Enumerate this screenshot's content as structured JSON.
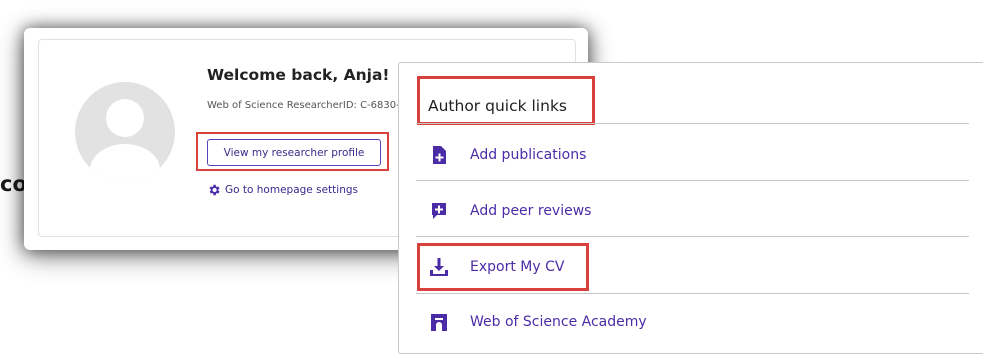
{
  "welcome": {
    "title": "Welcome back, Anja!",
    "researcher_id": "Web of Science ResearcherID: C-6830-",
    "profile_button": "View my researcher profile",
    "settings_link": "Go to homepage settings"
  },
  "partial_text": "co",
  "quick_links": {
    "title": "Author quick links",
    "items": [
      {
        "label": "Add publications",
        "icon": "document-plus-icon"
      },
      {
        "label": "Add peer reviews",
        "icon": "review-plus-icon"
      },
      {
        "label": "Export My CV",
        "icon": "download-icon"
      },
      {
        "label": "Web of Science Academy",
        "icon": "academy-icon"
      }
    ]
  },
  "colors": {
    "accent": "#4b2ca6",
    "highlight": "#d9423c",
    "avatar": "#e2e2e2"
  }
}
